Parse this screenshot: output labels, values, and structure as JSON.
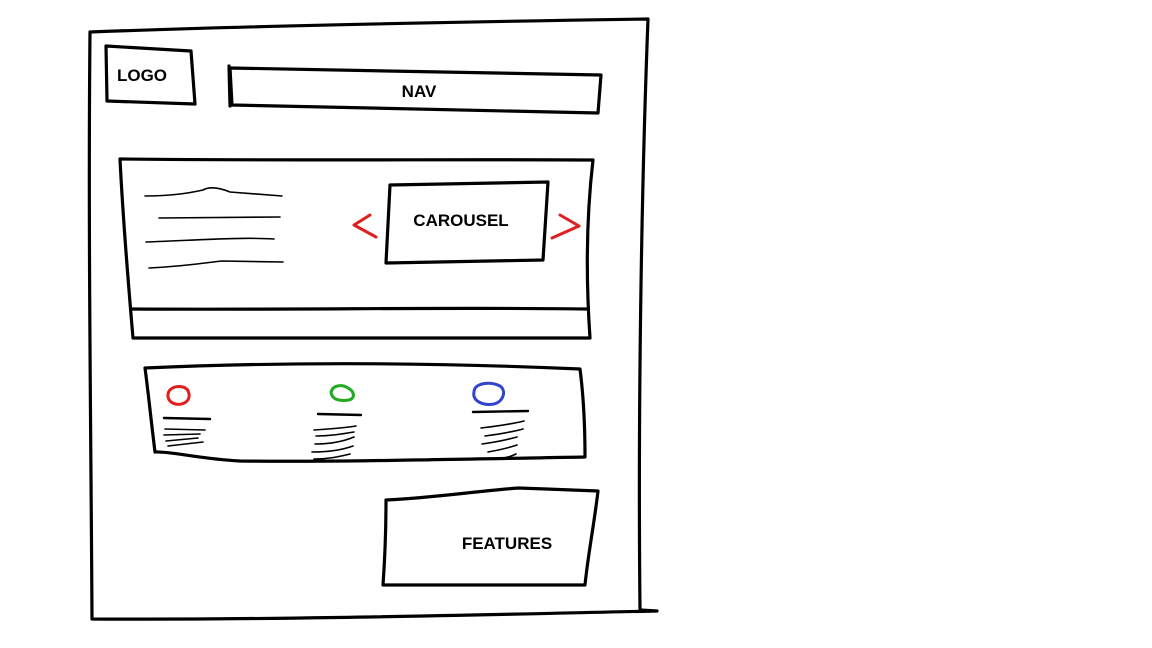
{
  "wireframe": {
    "logo_label": "LOGO",
    "nav_label": "NAV",
    "carousel_label": "CAROUSEL",
    "features_label": "FEATURES",
    "colors": {
      "ink": "#000000",
      "prev_arrow": "#e02020",
      "next_arrow": "#e02020",
      "card_1_icon": "#e02020",
      "card_2_icon": "#22aa22",
      "card_3_icon": "#3344cc"
    },
    "icons": {
      "prev_arrow": "chevron-left-icon",
      "next_arrow": "chevron-right-icon",
      "card_1": "circle-icon",
      "card_2": "circle-icon",
      "card_3": "circle-icon"
    }
  }
}
